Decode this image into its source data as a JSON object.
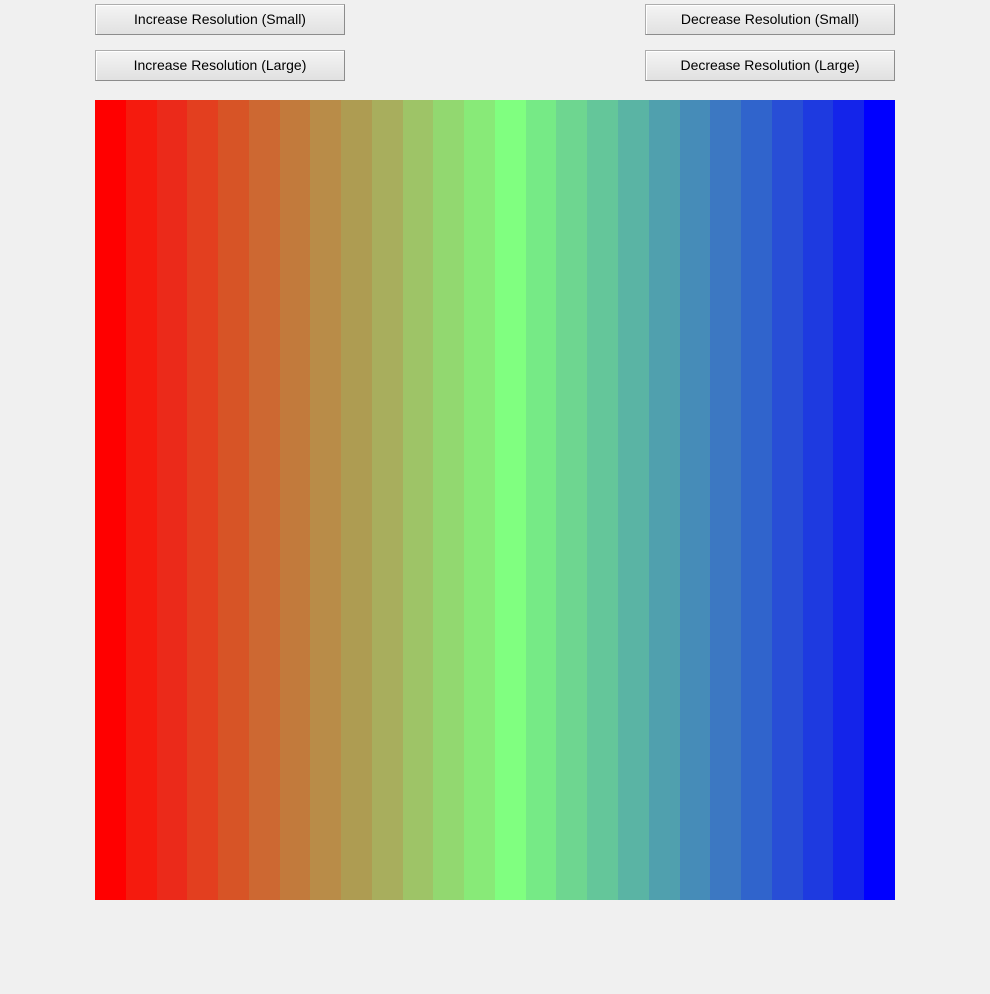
{
  "controls": {
    "increase_small": "Increase Resolution (Small)",
    "decrease_small": "Decrease Resolution (Small)",
    "increase_large": "Increase Resolution (Large)",
    "decrease_large": "Decrease Resolution (Large)"
  },
  "gradient": {
    "stripe_count": 26,
    "start_color": "#ff0000",
    "mid_color": "#80ff80",
    "end_color": "#0000ff",
    "stripes": [
      "#ff0000",
      "#f51b0e",
      "#eb2a1a",
      "#e33f1f",
      "#d75426",
      "#cd6832",
      "#c27a3c",
      "#b98c48",
      "#ae9c52",
      "#a8ae5d",
      "#9ec467",
      "#92d870",
      "#88ea78",
      "#80ff80",
      "#76ea86",
      "#6ed690",
      "#64c69a",
      "#5ab4a4",
      "#50a0ae",
      "#468cb8",
      "#3c78c2",
      "#3064cc",
      "#284ed6",
      "#1e3ae0",
      "#1424ea",
      "#0000ff"
    ]
  }
}
